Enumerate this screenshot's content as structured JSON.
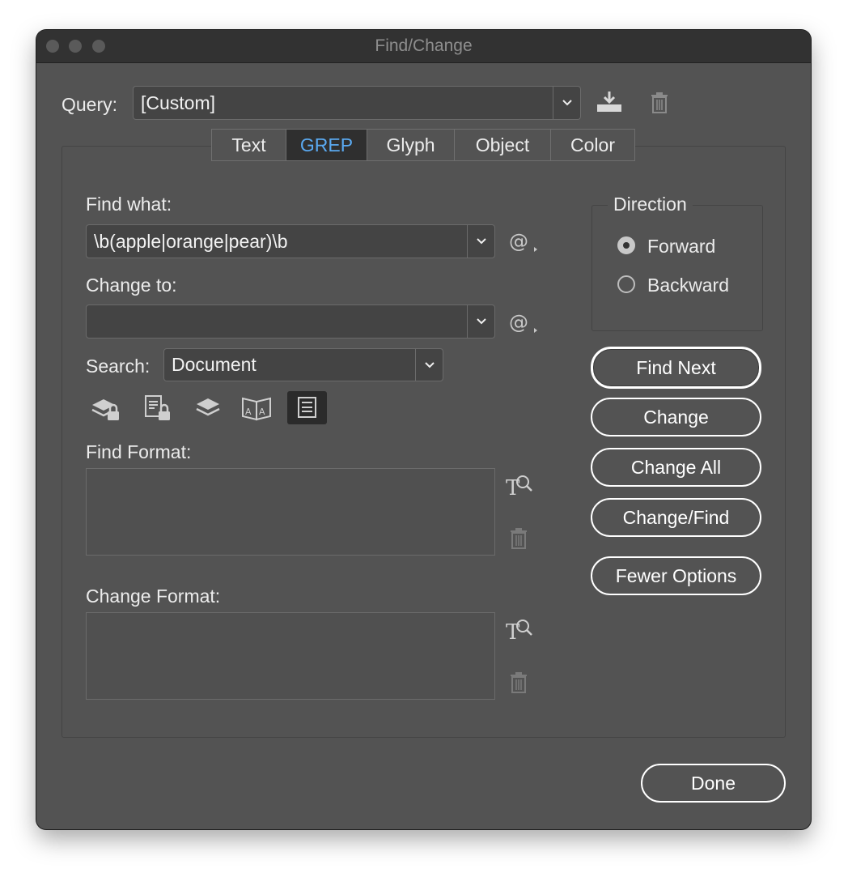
{
  "window": {
    "title": "Find/Change"
  },
  "query": {
    "label": "Query:",
    "value": "[Custom]"
  },
  "tabs": [
    {
      "label": "Text",
      "active": false
    },
    {
      "label": "GREP",
      "active": true
    },
    {
      "label": "Glyph",
      "active": false
    },
    {
      "label": "Object",
      "active": false
    },
    {
      "label": "Color",
      "active": false
    }
  ],
  "find_what": {
    "label": "Find what:",
    "value": "\\b(apple|orange|pear)\\b"
  },
  "change_to": {
    "label": "Change to:",
    "value": ""
  },
  "search": {
    "label": "Search:",
    "value": "Document"
  },
  "find_format": {
    "label": "Find Format:"
  },
  "change_format": {
    "label": "Change Format:"
  },
  "direction": {
    "label": "Direction",
    "forward_label": "Forward",
    "backward_label": "Backward",
    "selected": "Forward"
  },
  "buttons": {
    "find_next": "Find Next",
    "change": "Change",
    "change_all": "Change All",
    "change_find": "Change/Find",
    "fewer_options": "Fewer Options",
    "done": "Done"
  },
  "icons": {
    "save_query": "save-query-icon",
    "delete_query": "trash-icon",
    "special_chars": "at-sign-menu-icon",
    "locked_layers": "locked-layers-icon",
    "locked_stories": "locked-stories-icon",
    "hidden_layers": "hidden-layers-icon",
    "master_pages": "master-pages-icon",
    "footnotes": "footnotes-icon",
    "specify_format": "format-magnifier-icon"
  },
  "colors": {
    "accent": "#5aa9f0",
    "background": "#535353",
    "titlebar": "#323232"
  }
}
